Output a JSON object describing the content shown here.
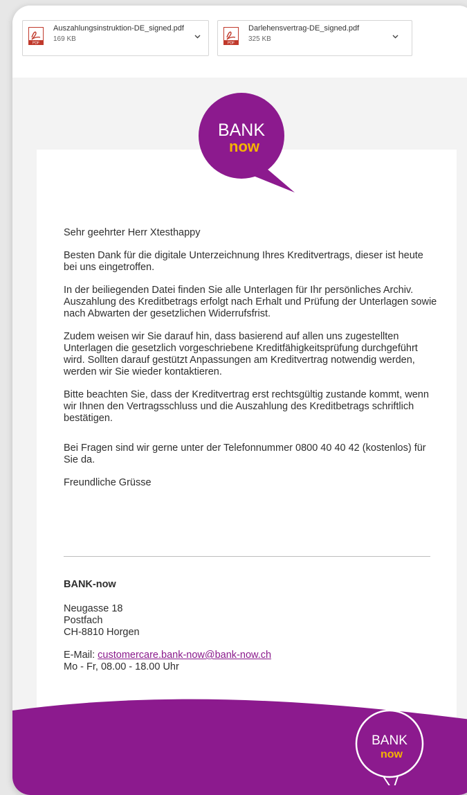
{
  "attachments": [
    {
      "name": "Auszahlungsinstruktion-DE_signed.pdf",
      "size": "169 KB",
      "icon": "pdf-icon"
    },
    {
      "name": "Darlehensvertrag-DE_signed.pdf",
      "size": "325 KB",
      "icon": "pdf-icon"
    }
  ],
  "logo": {
    "line1": "BANK",
    "line2": "now"
  },
  "email": {
    "greeting": "Sehr geehrter Herr Xtesthappy",
    "paragraphs": [
      "Besten Dank für die digitale Unterzeichnung Ihres Kreditvertrags, dieser ist heute bei uns eingetroffen.",
      "In der beiliegenden Datei finden Sie alle Unterlagen für Ihr persönliches Archiv. Auszahlung des Kreditbetrags erfolgt nach Erhalt und Prüfung der Unterlagen sowie nach Abwarten der gesetzlichen Widerrufsfrist.",
      "Zudem weisen wir Sie darauf hin, dass basierend auf allen uns zugestellten Unterlagen die gesetzlich vorgeschriebene Kreditfähigkeitsprüfung durchgeführt wird. Sollten darauf gestützt Anpassungen am Kreditvertrag notwendig werden, werden wir Sie wieder kontaktieren.",
      "Bitte beachten Sie, dass der Kreditvertrag erst rechtsgültig zustande kommt, wenn wir Ihnen den Vertragsschluss und die Auszahlung des Kreditbetrags schriftlich bestätigen."
    ],
    "contact": "Bei Fragen sind wir gerne unter der Telefonnummer 0800 40 40 42 (kostenlos) für Sie da.",
    "closing": "Freundliche Grüsse"
  },
  "signature": {
    "company": "BANK-now",
    "address": [
      "Neugasse 18",
      "Postfach",
      "CH-8810 Horgen"
    ],
    "email_label": "E-Mail: ",
    "email": "customercare.bank-now@bank-now.ch",
    "hours": "Mo - Fr, 08.00 - 18.00 Uhr"
  },
  "colors": {
    "brand": "#8c1a8e",
    "accent": "#f5b400",
    "link": "#8a1a8c"
  }
}
